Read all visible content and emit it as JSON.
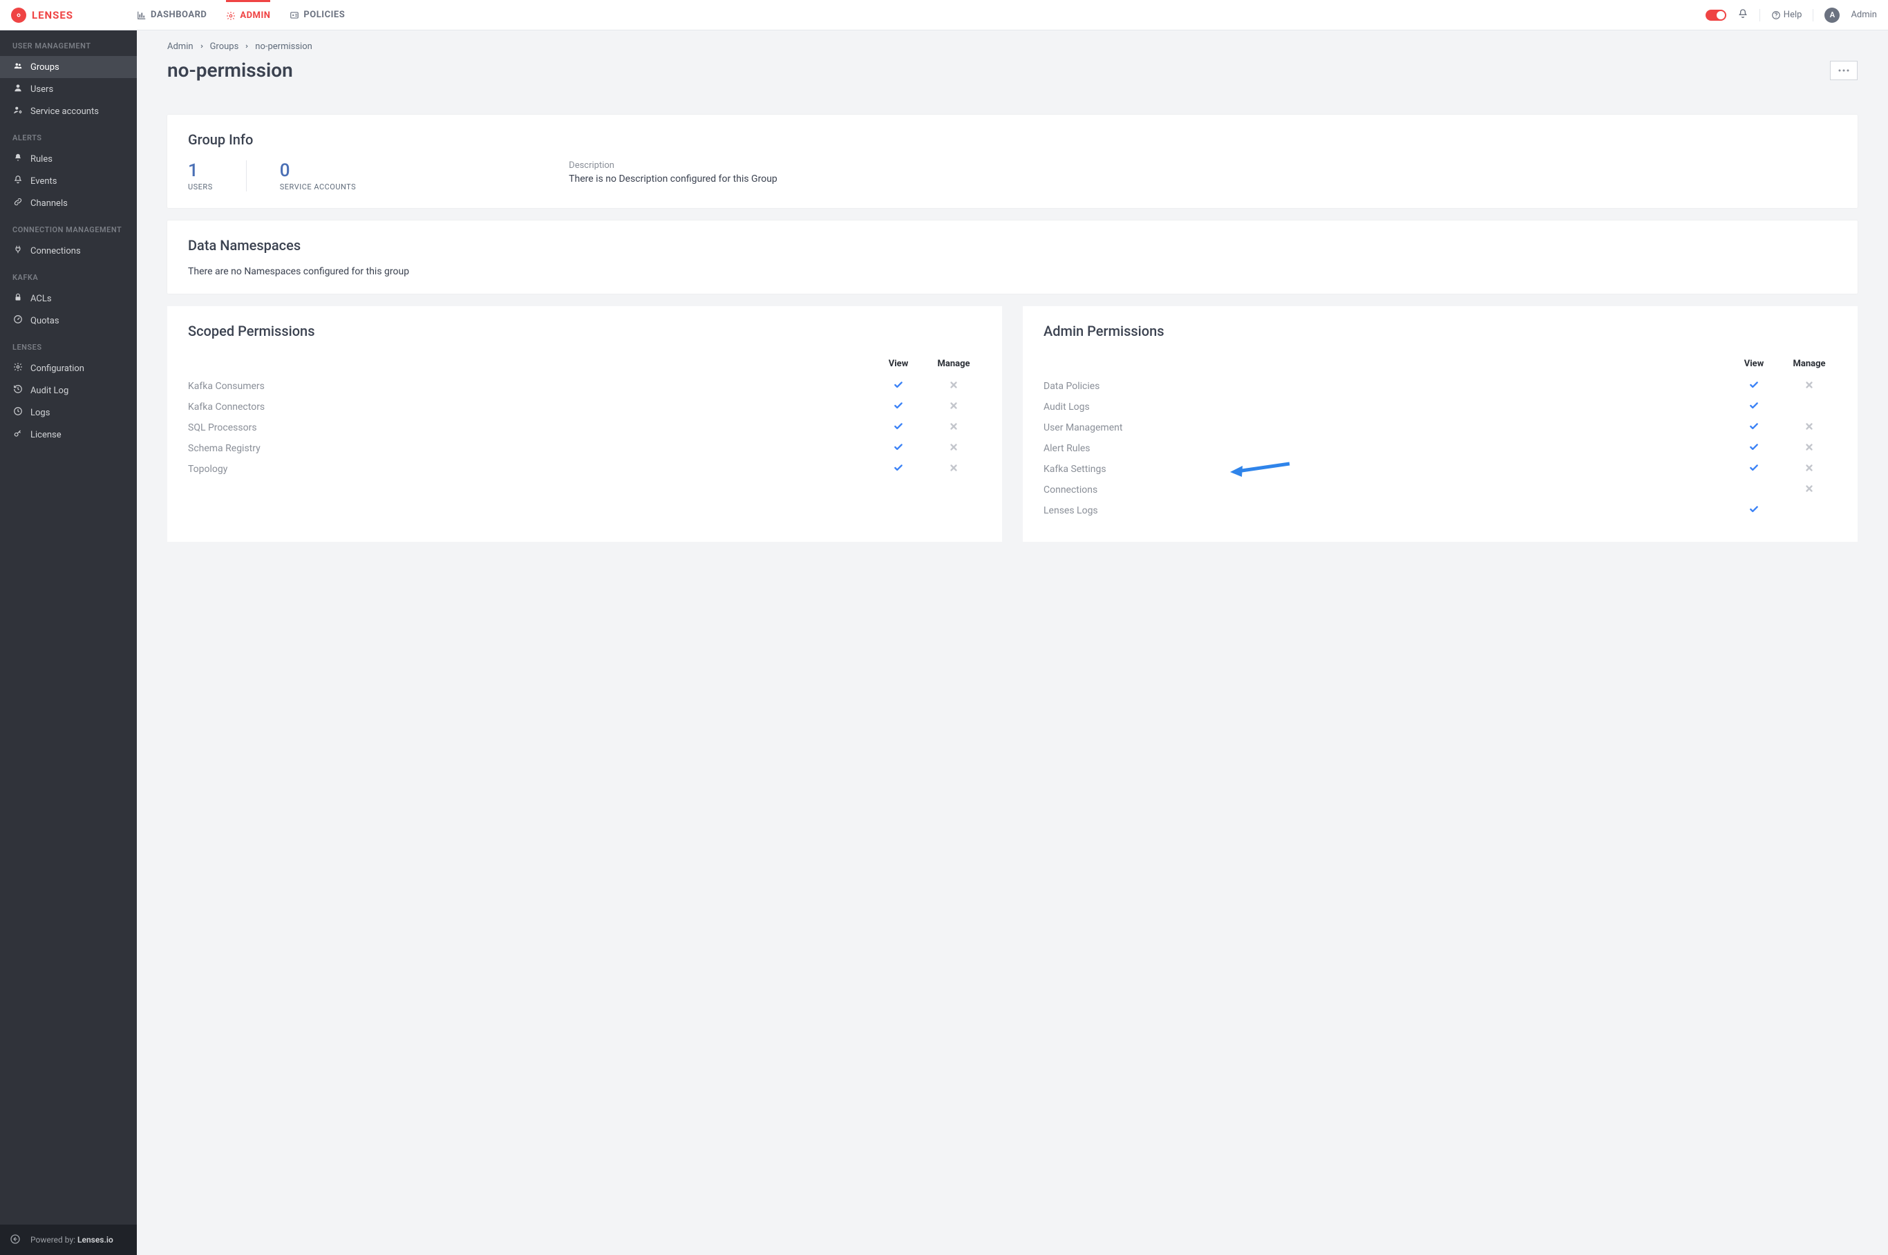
{
  "brand": "LENSES",
  "topnav": [
    {
      "label": "DASHBOARD",
      "active": false,
      "icon": "chart-bar"
    },
    {
      "label": "ADMIN",
      "active": true,
      "icon": "gear"
    },
    {
      "label": "POLICIES",
      "active": false,
      "icon": "id-card"
    }
  ],
  "help_label": "Help",
  "user": {
    "initial": "A",
    "name": "Admin"
  },
  "sidebar": {
    "sections": [
      {
        "title": "USER MANAGEMENT",
        "items": [
          {
            "label": "Groups",
            "icon": "users",
            "active": true
          },
          {
            "label": "Users",
            "icon": "user",
            "active": false
          },
          {
            "label": "Service accounts",
            "icon": "user-gear",
            "active": false
          }
        ]
      },
      {
        "title": "ALERTS",
        "items": [
          {
            "label": "Rules",
            "icon": "bell-solid",
            "active": false
          },
          {
            "label": "Events",
            "icon": "bell",
            "active": false
          },
          {
            "label": "Channels",
            "icon": "link",
            "active": false
          }
        ]
      },
      {
        "title": "CONNECTION MANAGEMENT",
        "items": [
          {
            "label": "Connections",
            "icon": "plug",
            "active": false
          }
        ]
      },
      {
        "title": "KAFKA",
        "items": [
          {
            "label": "ACLs",
            "icon": "lock",
            "active": false
          },
          {
            "label": "Quotas",
            "icon": "gauge",
            "active": false
          }
        ]
      },
      {
        "title": "LENSES",
        "items": [
          {
            "label": "Configuration",
            "icon": "gear",
            "active": false
          },
          {
            "label": "Audit Log",
            "icon": "history",
            "active": false
          },
          {
            "label": "Logs",
            "icon": "clock",
            "active": false
          },
          {
            "label": "License",
            "icon": "key",
            "active": false
          }
        ]
      }
    ],
    "footer": {
      "powered_prefix": "Powered by: ",
      "powered_name": "Lenses.io"
    }
  },
  "breadcrumbs": [
    "Admin",
    "Groups",
    "no-permission"
  ],
  "page_title": "no-permission",
  "group_info": {
    "title": "Group Info",
    "users_count": "1",
    "users_label": "USERS",
    "sa_count": "0",
    "sa_label": "SERVICE ACCOUNTS",
    "desc_label": "Description",
    "desc_text": "There is no Description configured for this Group"
  },
  "namespaces": {
    "title": "Data Namespaces",
    "empty": "There are no Namespaces configured for this group"
  },
  "perm_headers": {
    "view": "View",
    "manage": "Manage"
  },
  "scoped": {
    "title": "Scoped Permissions",
    "rows": [
      {
        "name": "Kafka Consumers",
        "view": true,
        "manage": false
      },
      {
        "name": "Kafka Connectors",
        "view": true,
        "manage": false
      },
      {
        "name": "SQL Processors",
        "view": true,
        "manage": false
      },
      {
        "name": "Schema Registry",
        "view": true,
        "manage": false
      },
      {
        "name": "Topology",
        "view": true,
        "manage": false
      }
    ]
  },
  "admin_perms": {
    "title": "Admin Permissions",
    "rows": [
      {
        "name": "Data Policies",
        "view": true,
        "manage": false
      },
      {
        "name": "Audit Logs",
        "view": true,
        "manage": null
      },
      {
        "name": "User Management",
        "view": true,
        "manage": false
      },
      {
        "name": "Alert Rules",
        "view": true,
        "manage": false
      },
      {
        "name": "Kafka Settings",
        "view": true,
        "manage": false
      },
      {
        "name": "Connections",
        "view": null,
        "manage": false
      },
      {
        "name": "Lenses Logs",
        "view": true,
        "manage": null
      }
    ]
  }
}
